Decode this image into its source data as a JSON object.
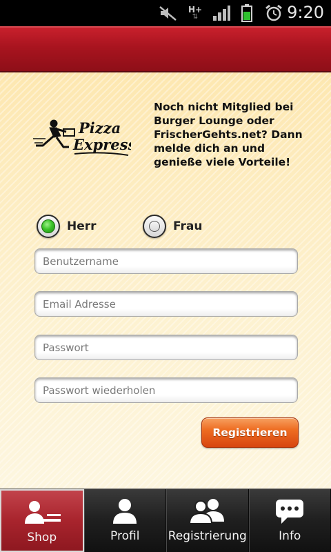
{
  "status_bar": {
    "time": "9:20",
    "network_type": "H+",
    "icons": [
      "mute-icon",
      "network-type-icon",
      "signal-icon",
      "battery-icon",
      "alarm-icon"
    ]
  },
  "header": {},
  "intro": {
    "text": "Noch nicht Mitglied bei\nBurger Lounge oder\nFrischerGehts.net? Dann\nmelde dich an und\ngenieße viele Vorteile!"
  },
  "logo": {
    "line1": "Pizza",
    "line2": "Express"
  },
  "gender": {
    "options": [
      {
        "label": "Herr",
        "selected": true
      },
      {
        "label": "Frau",
        "selected": false
      }
    ]
  },
  "form": {
    "username_placeholder": "Benutzername",
    "email_placeholder": "Email Adresse",
    "password_placeholder": "Passwort",
    "password_repeat_placeholder": "Passwort wiederholen",
    "submit_label": "Registrieren"
  },
  "tabs": [
    {
      "label": "Shop",
      "icon": "delivery-person-icon",
      "active": true
    },
    {
      "label": "Profil",
      "icon": "person-icon",
      "active": false
    },
    {
      "label": "Registrierung",
      "icon": "people-icon",
      "active": false
    },
    {
      "label": "Info",
      "icon": "chat-bubble-icon",
      "active": false
    }
  ],
  "colors": {
    "header_red": "#a8141f",
    "button_orange": "#ee6d22",
    "radio_green": "#3cc42a",
    "background_cream": "#fdf3cf"
  }
}
